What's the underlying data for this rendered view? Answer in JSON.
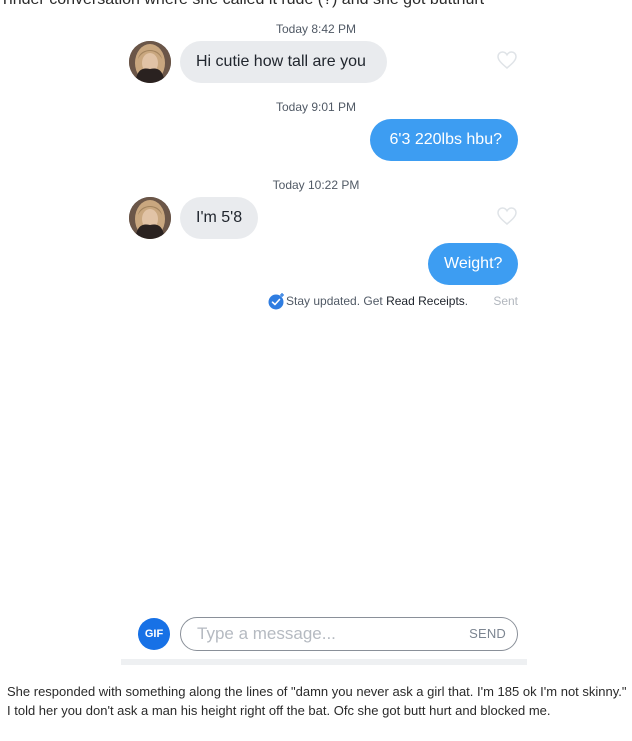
{
  "post": {
    "title_fragment": "Tinder conversation where she called it rude (?) and she got butthurt",
    "caption": "She responded with something along the lines of \"damn you never ask a girl that. I'm 185 ok I'm not skinny.\" I told her you don't ask a man his height right off the bat. Ofc she got butt hurt and blocked me."
  },
  "chat": {
    "messages": [
      {
        "time": "Today 8:42 PM",
        "direction": "incoming",
        "text": "Hi cutie how tall are you"
      },
      {
        "time": "Today 9:01 PM",
        "direction": "outgoing",
        "text": "6'3 220lbs hbu?"
      },
      {
        "time": "Today 10:22 PM",
        "direction": "incoming",
        "text": "I'm 5'8"
      },
      {
        "time": "",
        "direction": "outgoing",
        "text": "Weight?"
      }
    ],
    "receipt": {
      "prefix": "Stay updated. Get ",
      "link": "Read Receipts",
      "suffix": ".",
      "status": "Sent"
    }
  },
  "composer": {
    "gif_label": "GIF",
    "placeholder": "Type a message...",
    "send_label": "SEND"
  },
  "colors": {
    "outgoing_bubble": "#3d9df2",
    "incoming_bubble": "#e9ebee",
    "gif_button": "#1771e6",
    "timestamp_text": "#505965"
  },
  "icons": [
    "avatar-photo",
    "heart-outline-icon",
    "read-receipt-check-icon"
  ]
}
